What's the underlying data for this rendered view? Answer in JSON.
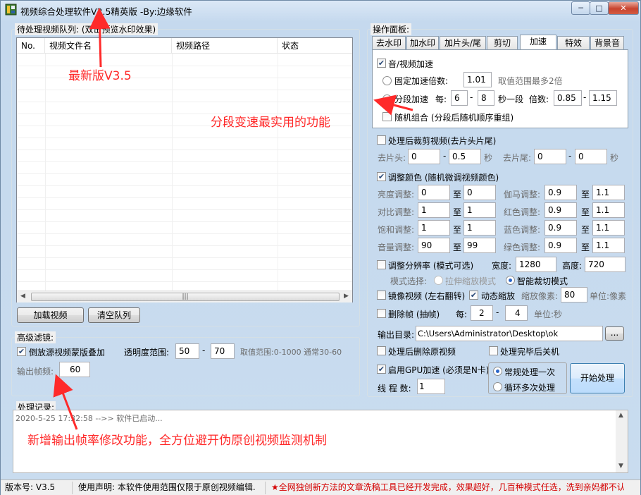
{
  "window": {
    "title": "视频综合处理软件V3.5精英版  -By:边缘软件",
    "controls": [
      "─",
      "□",
      "✕"
    ]
  },
  "queue": {
    "label": "待处理视频队列: (双击预览水印效果)",
    "columns": [
      "No.",
      "视频文件名",
      "视频路径",
      "状态"
    ],
    "scroll_grip": "|||",
    "load_button": "加载视频",
    "clear_button": "清空队列"
  },
  "filter": {
    "label": "高级滤镜:",
    "reverse_overlay_label": "倒放源视频蒙版叠加",
    "reverse_overlay_checked": true,
    "transparency_label": "透明度范围:",
    "transparency_min": "50",
    "transparency_max": "70",
    "transparency_hint": "取值范围:0-1000 通常30-60",
    "fps_label": "输出帧频:",
    "fps_value": "60"
  },
  "log": {
    "label": "处理记录:",
    "entry": "2020-5-25 17:32:58 -->> 软件已启动..."
  },
  "panel": {
    "label": "操作面板:",
    "tabs": [
      "去水印",
      "加水印",
      "加片头/尾",
      "剪切",
      "加速",
      "特效",
      "背景音"
    ],
    "active_tab": "加速",
    "speed": {
      "enable_label": "音/视频加速",
      "enable_checked": true,
      "fixed_label": "固定加速倍数:",
      "fixed_value": "1.01",
      "fixed_hint": "取值范围最多2倍",
      "segment_label": "分段加速",
      "segment_every": "每:",
      "seg_from": "6",
      "seg_to": "8",
      "seg_unit": "秒一段",
      "ratio_label": "倍数:",
      "ratio_from": "0.85",
      "ratio_to": "1.15",
      "random_label": "随机组合 (分段后随机顺序重组)",
      "random_checked": false
    },
    "trim": {
      "enable_label": "处理后裁剪视频(去片头片尾)",
      "enable_checked": false,
      "head_label": "去片头:",
      "head_from": "0",
      "head_to": "0.5",
      "head_unit": "秒",
      "tail_label": "去片尾:",
      "tail_from": "0",
      "tail_to": "0",
      "tail_unit": "秒"
    },
    "color": {
      "enable_label": "调整颜色 (随机微调视频颜色)",
      "enable_checked": true,
      "to": "至",
      "rows": [
        {
          "l_label": "亮度调整:",
          "l_from": "0",
          "l_to": "0",
          "r_label": "伽马调整:",
          "r_from": "0.9",
          "r_to": "1.1"
        },
        {
          "l_label": "对比调整:",
          "l_from": "1",
          "l_to": "1",
          "r_label": "红色调整:",
          "r_from": "0.9",
          "r_to": "1.1"
        },
        {
          "l_label": "饱和调整:",
          "l_from": "1",
          "l_to": "1",
          "r_label": "蓝色调整:",
          "r_from": "0.9",
          "r_to": "1.1"
        },
        {
          "l_label": "音量调整:",
          "l_from": "90",
          "l_to": "99",
          "r_label": "绿色调整:",
          "r_from": "0.9",
          "r_to": "1.1"
        }
      ]
    },
    "resolution": {
      "enable_label": "调整分辨率 (模式可选)",
      "enable_checked": false,
      "width_label": "宽度:",
      "width": "1280",
      "height_label": "高度:",
      "height": "720",
      "mode_label": "模式选择:",
      "stretch_label": "拉伸缩放模式",
      "smart_label": "智能裁切模式"
    },
    "mirror": {
      "label": "镜像视频 (左右翻转)",
      "checked": false,
      "zoom_label": "动态缩放",
      "zoom_checked": true,
      "pixels_label": "缩放像素:",
      "pixels": "80",
      "pixels_unit": "单位:像素"
    },
    "frames": {
      "label": "删除帧 (抽帧)",
      "checked": false,
      "every_label": "每:",
      "from": "2",
      "to": "4",
      "unit": "单位:秒"
    },
    "output": {
      "dir_label": "输出目录:",
      "dir": "C:\\Users\\Administrator\\Desktop\\ok",
      "browse": "..."
    },
    "after": {
      "delete_label": "处理后删除原视频",
      "delete_checked": false,
      "shutdown_label": "处理完毕后关机",
      "shutdown_checked": false
    },
    "gpu": {
      "label": "启用GPU加速 (必须是N卡)",
      "checked": true,
      "threads_label": "线 程 数:",
      "threads": "1"
    },
    "mode": {
      "normal_label": "常规处理一次",
      "loop_label": "循环多次处理",
      "selected": "常规处理一次"
    },
    "start_button": "开始处理"
  },
  "status": {
    "version": "版本号: V3.5",
    "usage": "使用声明: 本软件使用范围仅限于原创视频编辑.",
    "ad": "★全网独创新方法的文章洗稿工具已经开发完成，效果超好，几百种模式任选，洗到亲妈都不认"
  },
  "annotations": {
    "version_note": "最新版V3.5",
    "segment_note": "分段变速最实用的功能",
    "fps_note": "新增输出帧率修改功能，全方位避开伪原创视频监测机制"
  },
  "colors": {
    "annotation_red": "#ff2a2a",
    "status_red": "#d40000",
    "accent_blue": "#2a66c9"
  }
}
